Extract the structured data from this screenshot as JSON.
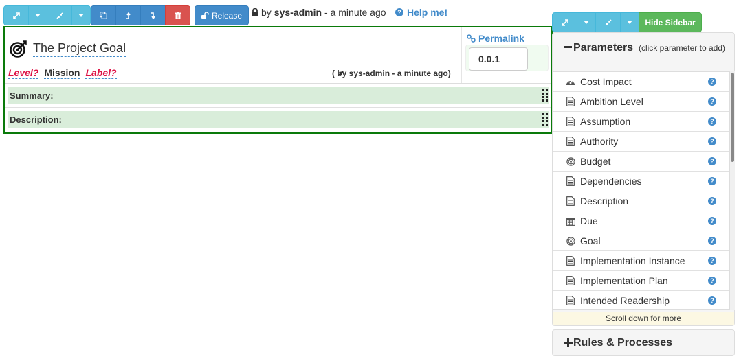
{
  "toolbar": {
    "expand_icon": "expand-arrows-icon",
    "collapse_icon": "compress-arrows-icon",
    "dropdown_icon": "caret-down-icon",
    "copy_icon": "copy-icon",
    "move_up_icon": "level-up-icon",
    "move_down_icon": "level-down-icon",
    "delete_icon": "trash-icon",
    "release_label": "Release",
    "lock_by_prefix": "by",
    "lock_user": "sys-admin",
    "lock_time": "- a minute ago",
    "help_label": "Help me!"
  },
  "element": {
    "icon": "bullseye-target-icon",
    "title": "The Project Goal",
    "level": "Level?",
    "type": "Mission",
    "label": "Label?",
    "edited_by": "( by sys-admin - a minute ago)",
    "permalink_label": "Permalink",
    "version": "0.0.1",
    "fields": [
      {
        "label": "Summary:"
      },
      {
        "label": "Description:"
      }
    ]
  },
  "sidebar": {
    "hide_label": "Hide Sidebar",
    "parameters": {
      "title": "Parameters",
      "hint": "(click parameter to add)",
      "items": [
        {
          "label": "Cost Impact",
          "icon": "dashboard-icon"
        },
        {
          "label": "Ambition Level",
          "icon": "document-icon"
        },
        {
          "label": "Assumption",
          "icon": "document-icon"
        },
        {
          "label": "Authority",
          "icon": "document-icon"
        },
        {
          "label": "Budget",
          "icon": "target-icon"
        },
        {
          "label": "Dependencies",
          "icon": "document-icon"
        },
        {
          "label": "Description",
          "icon": "document-icon"
        },
        {
          "label": "Due",
          "icon": "calendar-icon"
        },
        {
          "label": "Goal",
          "icon": "target-icon"
        },
        {
          "label": "Implementation Instance",
          "icon": "document-icon"
        },
        {
          "label": "Implementation Plan",
          "icon": "document-icon"
        },
        {
          "label": "Intended Readership",
          "icon": "document-icon"
        }
      ],
      "scroll_hint": "Scroll down for more"
    },
    "rules": {
      "title": "Rules & Processes"
    }
  },
  "colors": {
    "info": "#5bc0de",
    "primary": "#428bca",
    "danger": "#d9534f",
    "success": "#5cb85c",
    "panel_border": "#0a7a0a",
    "field_bg": "#d9edda",
    "missing": "#dd1144"
  }
}
